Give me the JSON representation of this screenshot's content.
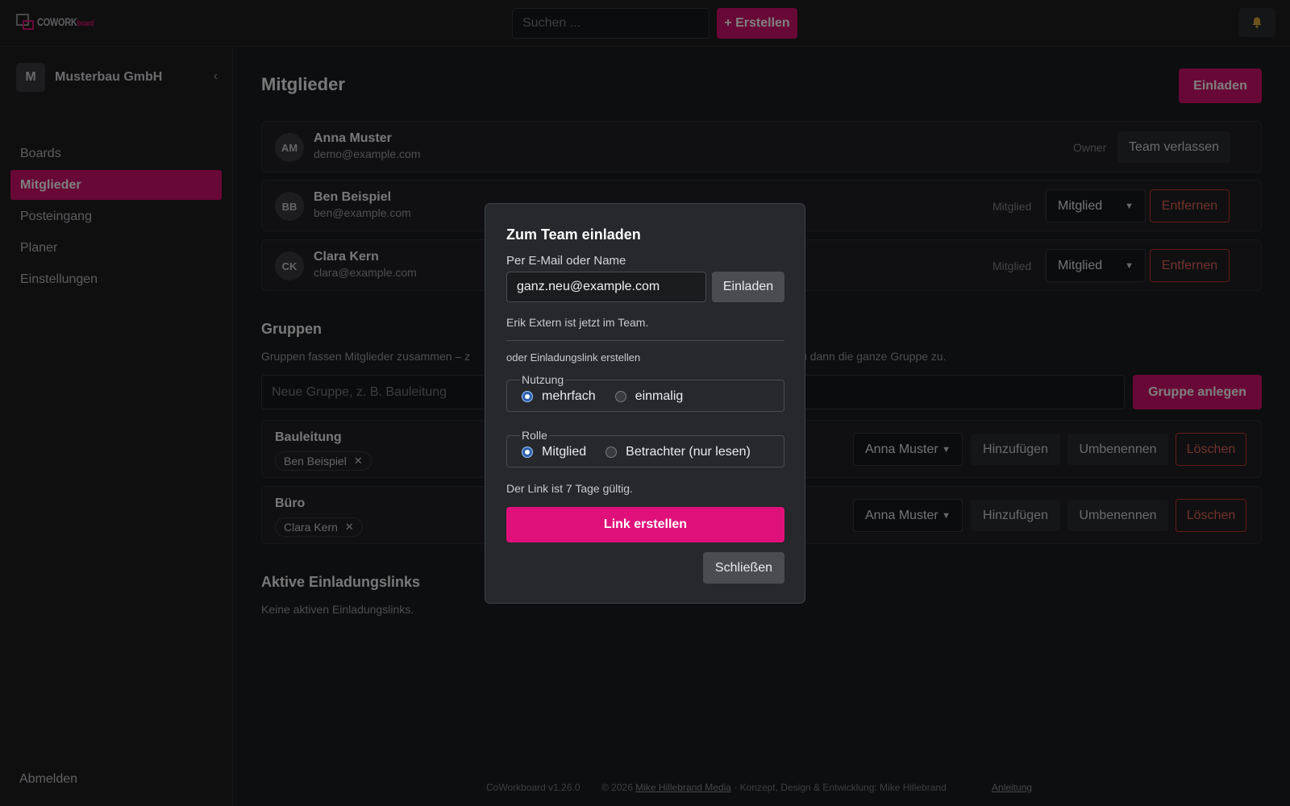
{
  "app": {
    "logo_text": "COWORK",
    "logo_suffix": "board",
    "search_placeholder": "Suchen ...",
    "create_label": "+ Erstellen",
    "accent_color": "#d1106c"
  },
  "sidebar": {
    "team_initial": "M",
    "team_name": "Musterbau GmbH",
    "collapse_glyph": "‹",
    "items": [
      {
        "label": "Boards"
      },
      {
        "label": "Mitglieder"
      },
      {
        "label": "Posteingang"
      },
      {
        "label": "Planer"
      },
      {
        "label": "Einstellungen"
      }
    ],
    "active_item": "Mitglieder",
    "logout_label": "Abmelden"
  },
  "main": {
    "title": "Mitglieder",
    "invite_label": "Einladen",
    "members": [
      {
        "initials": "AM",
        "name": "Anna Muster",
        "email": "demo@example.com",
        "role_label": "Owner",
        "action": "Team verlassen"
      },
      {
        "initials": "BB",
        "name": "Ben Beispiel",
        "email": "ben@example.com",
        "role_label": "Mitglied",
        "role_select": "Mitglied",
        "action": "Entfernen"
      },
      {
        "initials": "CK",
        "name": "Clara Kern",
        "email": "clara@example.com",
        "role_label": "Mitglied",
        "role_select": "Mitglied",
        "action": "Entfernen"
      }
    ],
    "groups": {
      "title": "Gruppen",
      "desc_left": "Gruppen fassen Mitglieder zusammen – z",
      "desc_right": "u dann die ganze Gruppe zu.",
      "input_placeholder": "Neue Gruppe, z. B. Bauleitung",
      "create_label": "Gruppe anlegen",
      "items": [
        {
          "name": "Bauleitung",
          "members": [
            "Ben Beispiel"
          ],
          "select": "Anna Muster",
          "add": "Hinzufügen",
          "rename": "Umbenennen",
          "delete": "Löschen"
        },
        {
          "name": "Büro",
          "members": [
            "Clara Kern"
          ],
          "select": "Anna Muster",
          "add": "Hinzufügen",
          "rename": "Umbenennen",
          "delete": "Löschen"
        }
      ]
    },
    "links": {
      "title": "Aktive Einladungslinks",
      "empty": "Keine aktiven Einladungslinks."
    }
  },
  "footer": {
    "version": "CoWorkboard v1.26.0",
    "copyright_prefix": "© 2026",
    "company_link": "Mike Hillebrand Media",
    "credits": "· Konzept, Design & Entwicklung: Mike Hillebrand",
    "manual_link": "Anleitung"
  },
  "modal": {
    "title": "Zum Team einladen",
    "field_label": "Per E-Mail oder Name",
    "field_value": "ganz.neu@example.com",
    "invite_label": "Einladen",
    "success_message": "Erik Extern ist jetzt im Team.",
    "link_subtitle": "oder Einladungslink erstellen",
    "usage": {
      "legend": "Nutzung",
      "options": [
        "mehrfach",
        "einmalig"
      ],
      "selected": "mehrfach"
    },
    "role": {
      "legend": "Rolle",
      "options": [
        "Mitglied",
        "Betrachter (nur lesen)"
      ],
      "selected": "Mitglied"
    },
    "validity_note": "Der Link ist 7 Tage gültig.",
    "create_link_label": "Link erstellen",
    "close_label": "Schließen"
  },
  "icons": {
    "bell": "bell-icon",
    "chevron": "chevron-down-icon",
    "remove_chip": "close-icon"
  }
}
